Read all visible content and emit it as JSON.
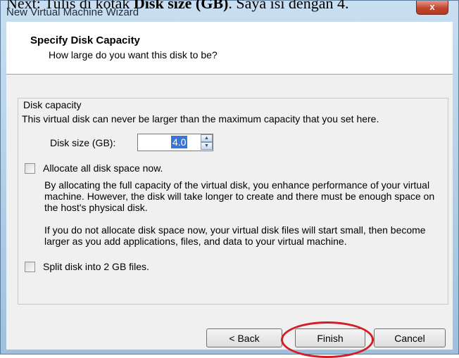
{
  "page": {
    "text_normal": "Next: Tulis di kotak ",
    "text_bold": "Disk size (GB)",
    "text_tail": ". Saya isi dengan 4."
  },
  "window": {
    "title": "New Virtual Machine Wizard",
    "close_glyph": "x"
  },
  "header": {
    "title": "Specify Disk Capacity",
    "subtitle": "How large do you want this disk to be?"
  },
  "disk_capacity": {
    "group_label": "Disk capacity",
    "description": "This virtual disk can never be larger than the maximum capacity that you set here.",
    "size_label": "Disk size (GB):",
    "size_value": "4.0",
    "spin_up": "▲",
    "spin_down": "▼"
  },
  "allocate": {
    "label": "Allocate all disk space now.",
    "checked": false,
    "para1": "By allocating the full capacity of the virtual disk, you enhance performance of your virtual machine. However, the disk will take longer to create and there must be enough space on the host's physical disk.",
    "para2": "If you do not allocate disk space now, your virtual disk files will start small, then become larger as you add applications, files, and data to your virtual machine."
  },
  "split": {
    "label": "Split disk into 2 GB files.",
    "checked": false
  },
  "buttons": {
    "back": "< Back",
    "finish": "Finish",
    "cancel": "Cancel"
  },
  "colors": {
    "annotation_circle": "#d21f25",
    "selection": "#3875d6"
  }
}
